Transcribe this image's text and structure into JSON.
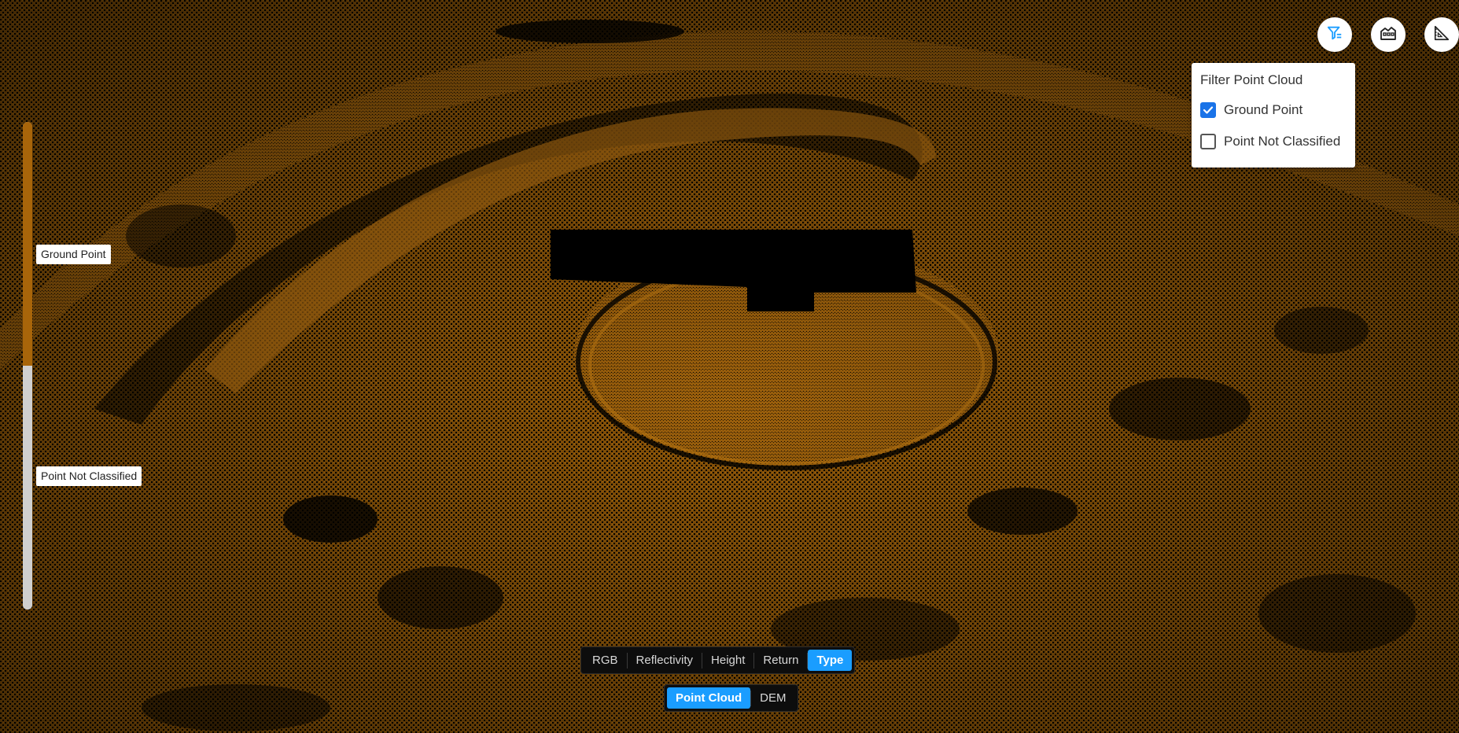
{
  "filter_panel": {
    "title": "Filter Point Cloud",
    "options": [
      {
        "label": "Ground Point",
        "checked": true
      },
      {
        "label": "Point Not Classified",
        "checked": false
      }
    ]
  },
  "legend": {
    "items": [
      {
        "label": "Ground Point",
        "color": "#a8650a"
      },
      {
        "label": "Point Not Classified",
        "color": "#d0d0d0"
      }
    ]
  },
  "toolbar": {
    "icons": [
      "filter-icon",
      "building-icon",
      "measure-icon"
    ]
  },
  "color_modes": {
    "buttons": [
      "RGB",
      "Reflectivity",
      "Height",
      "Return",
      "Type"
    ],
    "active": "Type"
  },
  "view_modes": {
    "buttons": [
      "Point Cloud",
      "DEM"
    ],
    "active": "Point Cloud"
  },
  "colors": {
    "accent": "#1a9dff",
    "point_cloud": "#a8650a",
    "background": "#000000"
  }
}
